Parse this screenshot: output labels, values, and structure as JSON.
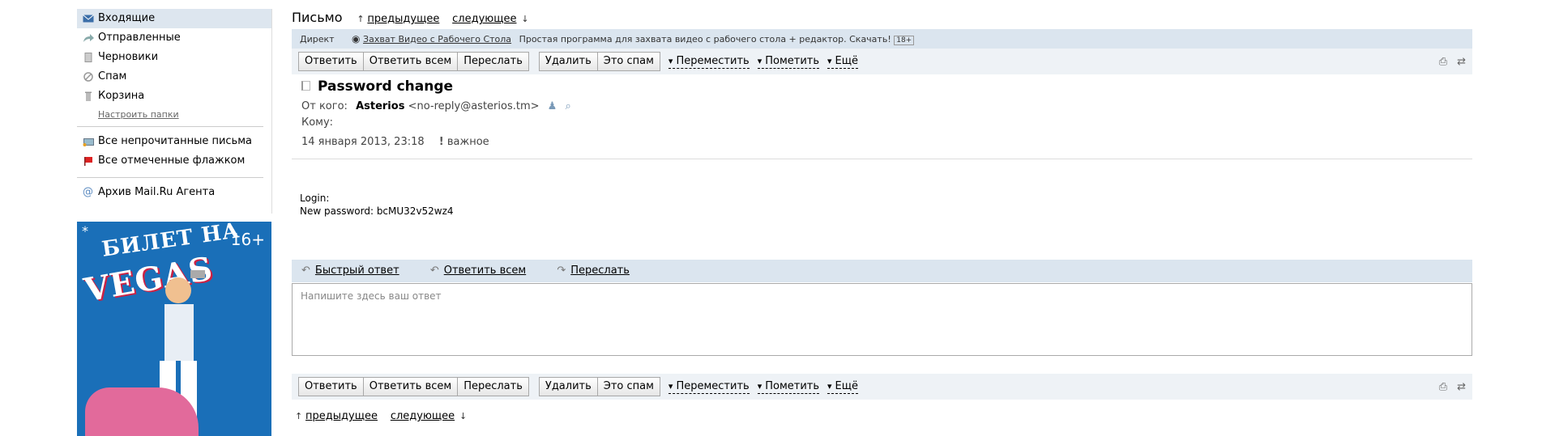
{
  "sidebar": {
    "folders": [
      {
        "label": "Входящие",
        "icon": "envelope-icon"
      },
      {
        "label": "Отправленные",
        "icon": "sent-arrow-icon"
      },
      {
        "label": "Черновики",
        "icon": "draft-icon"
      },
      {
        "label": "Спам",
        "icon": "spam-icon"
      },
      {
        "label": "Корзина",
        "icon": "trash-icon"
      }
    ],
    "setup_link": "Настроить папки",
    "unread": "Все непрочитанные письма",
    "flagged": "Все отмеченные флажком",
    "archive": "Архив Mail.Ru Агента"
  },
  "ad": {
    "title1": "БИЛЕТ НА",
    "title2": "VEGAS",
    "age": "16+",
    "star": "*"
  },
  "header": {
    "title": "Письмо",
    "prev": "предыдущее",
    "next": "следующее"
  },
  "direct": {
    "label": "Директ",
    "link": "Захват Видео с Рабочего Стола",
    "text": "Простая программа для захвата видео с рабочего стола + редактор. Скачать!",
    "badge": "18+"
  },
  "toolbar": {
    "reply": "Ответить",
    "reply_all": "Ответить всем",
    "forward": "Переслать",
    "delete": "Удалить",
    "spam": "Это спам",
    "move": "Переместить",
    "mark": "Пометить",
    "more": "Ещё"
  },
  "message": {
    "subject": "Password change",
    "from_label": "От кого:",
    "from_name": "Asterios",
    "from_email": "<no-reply@asterios.tm>",
    "to_label": "Кому:",
    "date": "14 января 2013, 23:18",
    "important": "важное",
    "body_line1": "Login:",
    "body_line2": "New password: bcMU32v52wz4"
  },
  "quick": {
    "reply": "Быстрый ответ",
    "reply_all": "Ответить всем",
    "forward": "Переслать",
    "placeholder": "Напишите здесь ваш ответ"
  }
}
